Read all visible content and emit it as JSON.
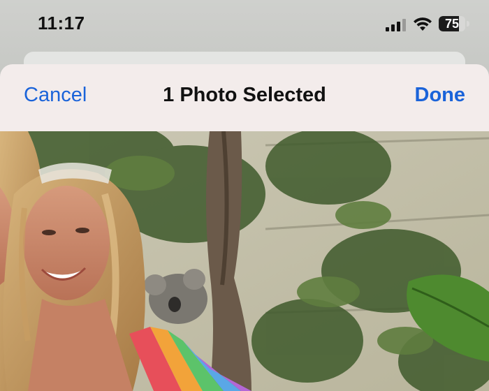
{
  "status_bar": {
    "time": "11:17",
    "battery_level": "75",
    "battery_fraction": 0.75,
    "icons": [
      "signal-icon",
      "wifi-icon",
      "battery-icon"
    ]
  },
  "nav": {
    "cancel_label": "Cancel",
    "title": "1 Photo Selected",
    "done_label": "Done"
  },
  "colors": {
    "accent": "#1a63d9",
    "nav_background": "#f3eceb"
  },
  "photo": {
    "subject": "selected-photo"
  }
}
